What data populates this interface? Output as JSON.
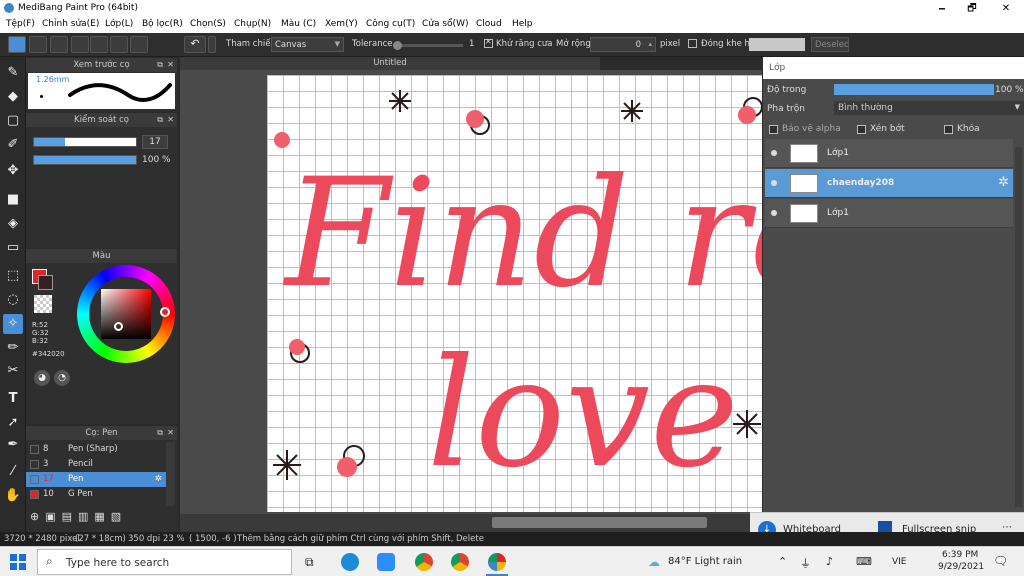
{
  "window": {
    "title": "MediBang Paint Pro (64bit)",
    "minimize": "🗕",
    "maximize": "🗗",
    "close": "✕"
  },
  "menu": [
    "Tệp(F)",
    "Chỉnh sửa(E)",
    "Lớp(L)",
    "Bộ lọc(R)",
    "Chọn(S)",
    "Chụp(N)",
    "Màu (C)",
    "Xem(Y)",
    "Công cụ(T)",
    "Cửa sổ(W)",
    "Cloud",
    "Help"
  ],
  "toolbar": {
    "reference_label": "Tham chiếu",
    "reference_value": "Canvas",
    "tolerance_label": "Tolerance",
    "tolerance_value": "1",
    "antialias_label": "Khử răng cưa",
    "expand_label": "Mở rộng",
    "expand_value": "0",
    "expand_unit": "pixel",
    "close_gap_label": "Đóng khe hở",
    "deselect_label": "Deselec"
  },
  "document": {
    "tab_title": "Untitled"
  },
  "canvas_text": {
    "line1": "Find rec",
    "line2": "love"
  },
  "preview_panel": {
    "title": "Xem trước cọ",
    "size": "1.26mm"
  },
  "brush_control": {
    "title": "Kiểm soát cọ",
    "size_value": "17",
    "opacity_value": "100 %",
    "size_fill": 0.3,
    "opacity_fill": 1.0
  },
  "color_panel": {
    "title": "Màu",
    "r": "R:52",
    "g": "G:32",
    "b": "B:32",
    "hex": "#342020",
    "primary": "#342020",
    "accent": "#e2232a"
  },
  "brush_panel": {
    "title": "Cọ: Pen",
    "items": [
      {
        "size": "8",
        "name": "Pen (Sharp)",
        "color": "#333333"
      },
      {
        "size": "3",
        "name": "Pencil",
        "color": "#333333"
      },
      {
        "size": "17",
        "name": "Pen",
        "color": "#4a8fd6"
      },
      {
        "size": "10",
        "name": "G Pen",
        "color": "#e2232a"
      }
    ]
  },
  "layer_panel": {
    "title": "Lớp",
    "opacity_label": "Độ trong",
    "opacity_value": "100 %",
    "opacity_fill": 1.0,
    "blend_label": "Pha trộn",
    "blend_value": "Bình thường",
    "protect_alpha": "Bảo vệ alpha",
    "clipping": "Xén bớt",
    "lock": "Khóa",
    "layers": [
      {
        "name": "Lớp1"
      },
      {
        "name": "chaenday208"
      },
      {
        "name": "Lớp1"
      }
    ]
  },
  "status": {
    "dimensions": "3720 * 2480 pixel",
    "physical": "(27 * 18cm)",
    "dpi": "350 dpi",
    "zoom": "23 %",
    "coords": "( 1500, -6 )",
    "hint": "Thêm bằng cách giữ phím Ctrl cùng với phím Shift, Delete"
  },
  "toast": {
    "item1": "Whiteboard",
    "item2": "Fullscreen snip",
    "more": "⋯"
  },
  "taskbar": {
    "search_placeholder": "Type here to search",
    "weather": "84°F  Light rain",
    "lang": "VIE",
    "time": "6:39 PM",
    "date": "9/29/2021"
  }
}
